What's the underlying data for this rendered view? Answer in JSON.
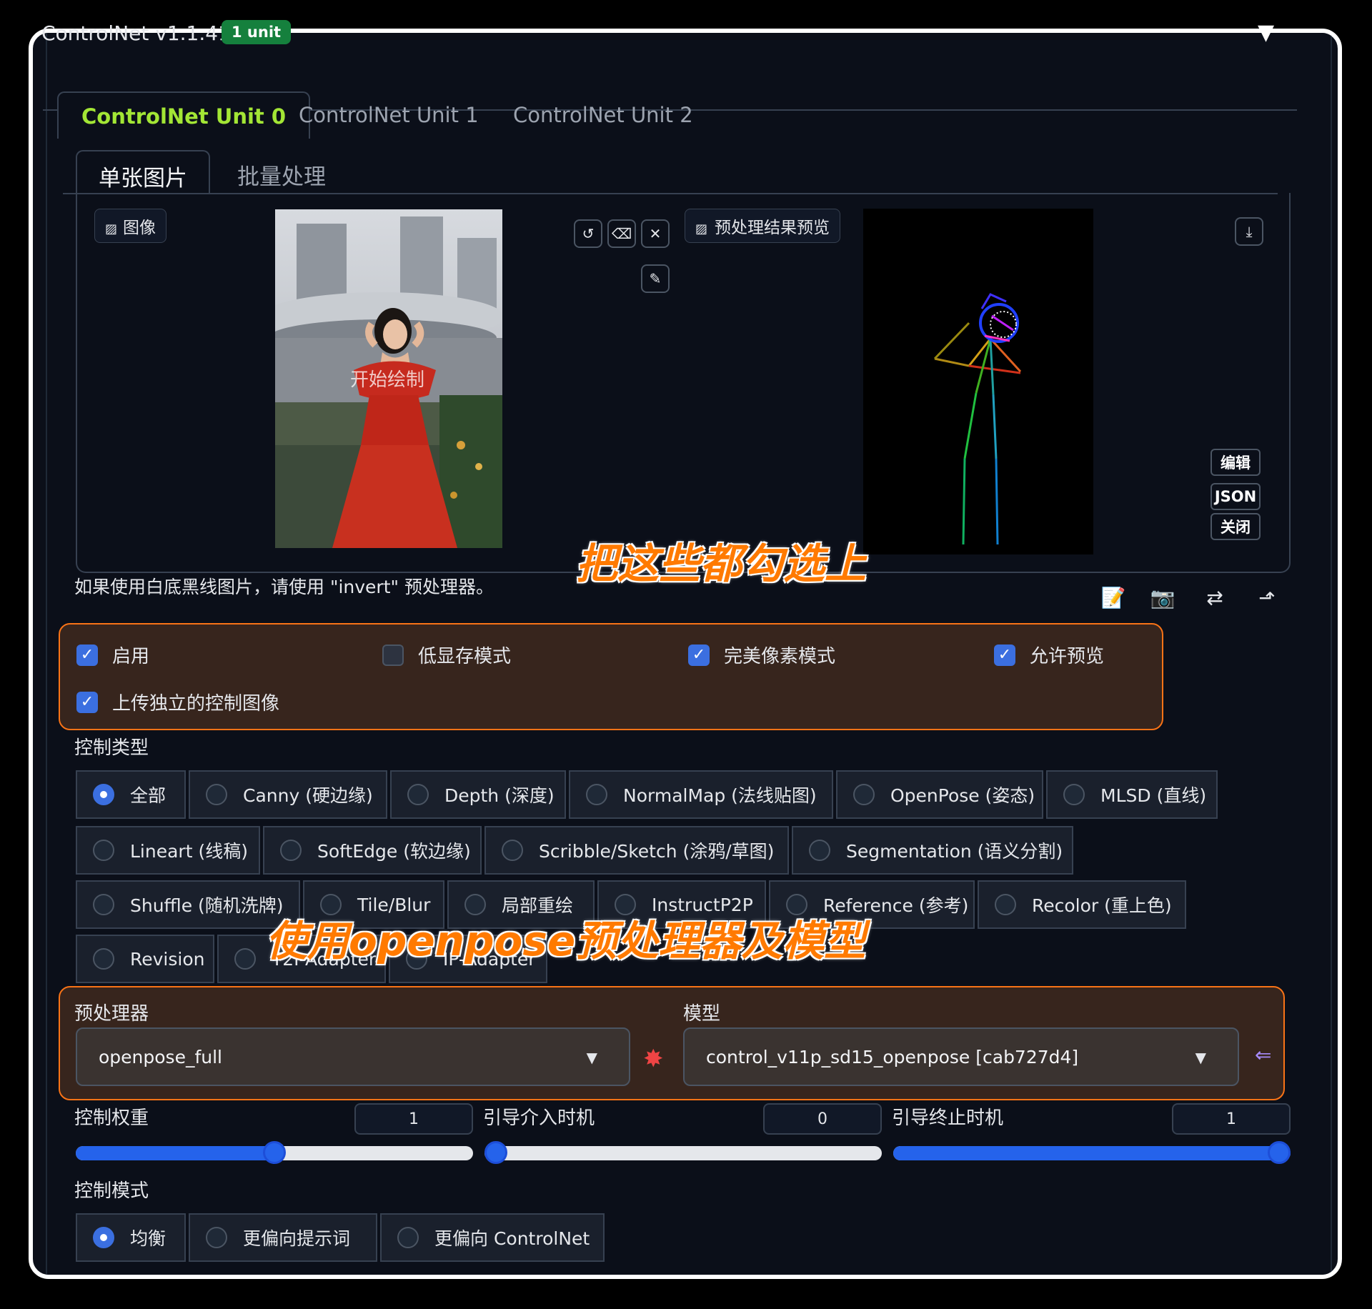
{
  "header": {
    "title": "ControlNet v1.1.410",
    "badge": "1 unit",
    "collapse_icon": "triangle-down-icon"
  },
  "unit_tabs": [
    "ControlNet Unit 0",
    "ControlNet Unit 1",
    "ControlNet Unit 2"
  ],
  "sub_tabs": [
    "单张图片",
    "批量处理"
  ],
  "image_panel": {
    "input_label": "图像",
    "photo_overlay": "开始绘制",
    "preview_label": "预处理结果预览",
    "side_buttons": [
      "编辑",
      "JSON",
      "关闭"
    ]
  },
  "hint": "如果使用白底黑线图片，请使用 \"invert\" 预处理器。",
  "annotations": {
    "check_note": "把这些都勾选上",
    "model_note": "使用openpose预处理器及模型"
  },
  "checkboxes": [
    {
      "label": "启用",
      "checked": true
    },
    {
      "label": "低显存模式",
      "checked": false
    },
    {
      "label": "完美像素模式",
      "checked": true
    },
    {
      "label": "允许预览",
      "checked": true
    },
    {
      "label": "上传独立的控制图像",
      "checked": true
    }
  ],
  "control_type": {
    "label": "控制类型",
    "options": [
      "全部",
      "Canny (硬边缘)",
      "Depth (深度)",
      "NormalMap (法线贴图)",
      "OpenPose (姿态)",
      "MLSD (直线)",
      "Lineart (线稿)",
      "SoftEdge (软边缘)",
      "Scribble/Sketch (涂鸦/草图)",
      "Segmentation (语义分割)",
      "Shuffle (随机洗牌)",
      "Tile/Blur",
      "局部重绘",
      "InstructP2P",
      "Reference (参考)",
      "Recolor (重上色)",
      "Revision",
      "T2I-Adapter",
      "IP-Adapter"
    ],
    "selected": "全部"
  },
  "preprocessor": {
    "label": "预处理器",
    "value": "openpose_full"
  },
  "model": {
    "label": "模型",
    "value": "control_v11p_sd15_openpose [cab727d4]"
  },
  "sliders": [
    {
      "label": "控制权重",
      "value": "1",
      "fraction": 0.5
    },
    {
      "label": "引导介入时机",
      "value": "0",
      "fraction": 0.0
    },
    {
      "label": "引导终止时机",
      "value": "1",
      "fraction": 1.0
    }
  ],
  "control_mode": {
    "label": "控制模式",
    "options": [
      "均衡",
      "更偏向提示词",
      "更偏向 ControlNet"
    ],
    "selected": "均衡"
  },
  "colors": {
    "accent": "#a3e635",
    "badge": "#15803d",
    "highlight": "#f97316",
    "blue": "#2563eb"
  }
}
